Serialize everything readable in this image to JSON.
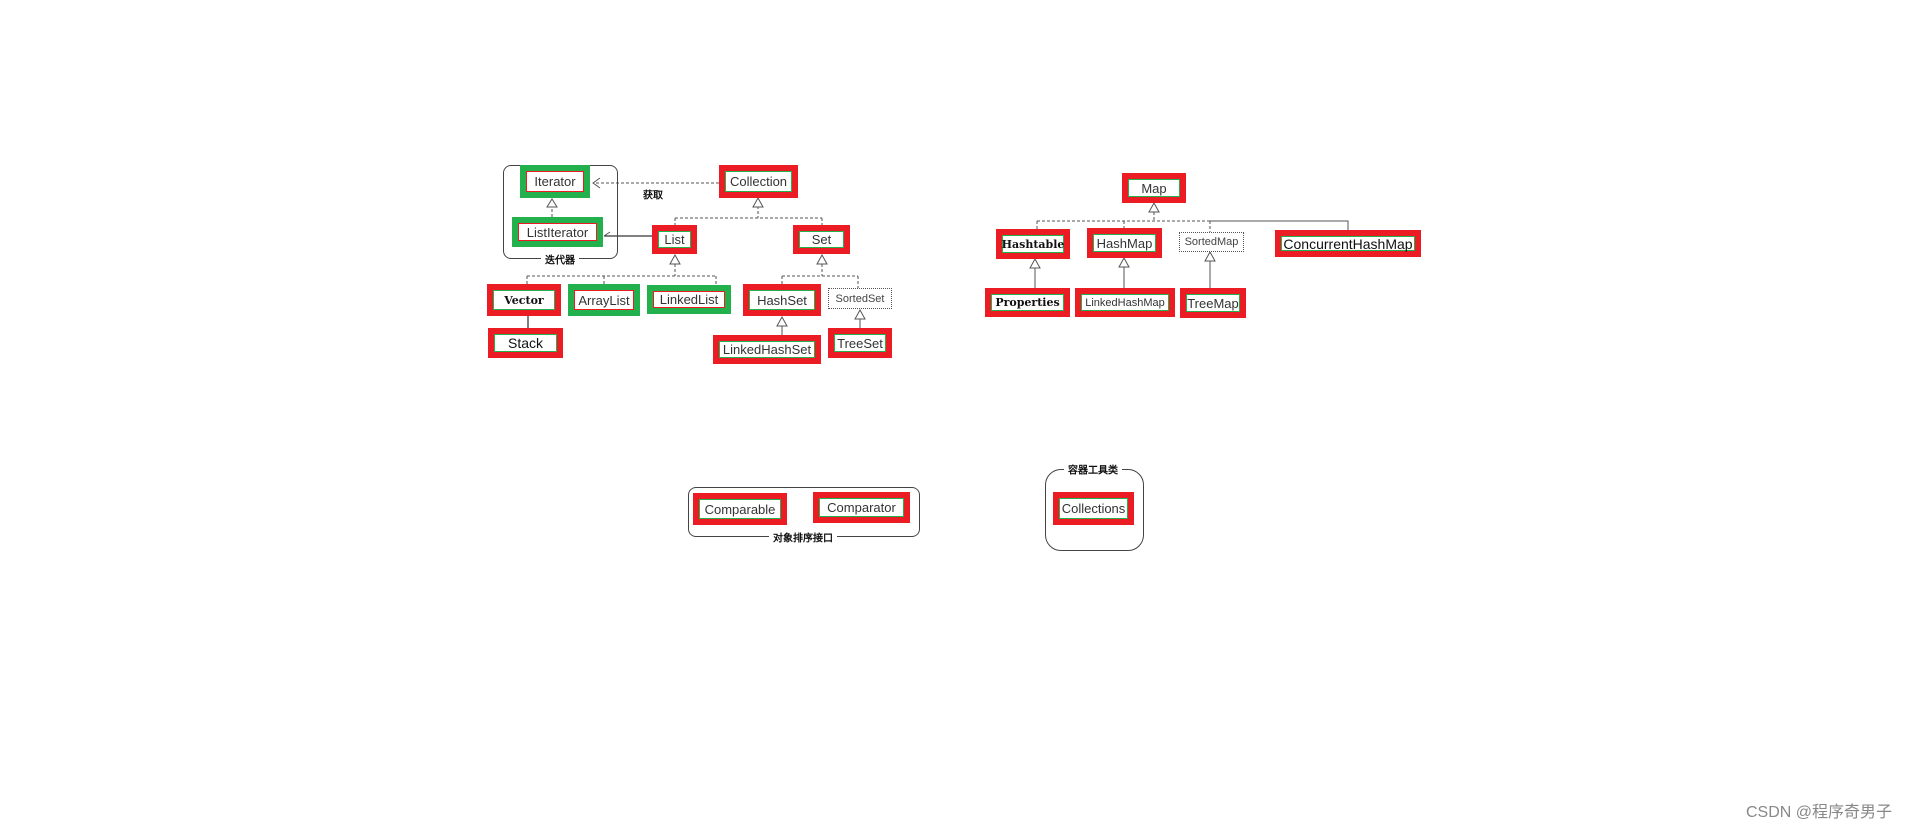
{
  "colors": {
    "highlight_red": "#ec1c24",
    "highlight_green": "#22b14c"
  },
  "collection_diagram": {
    "iterator_group_label": "迭代器",
    "get_label": "获取",
    "nodes": {
      "iterator": "Iterator",
      "list_iterator": "ListIterator",
      "collection": "Collection",
      "list": "List",
      "set": "Set",
      "vector": "Vector",
      "array_list": "ArrayList",
      "linked_list": "LinkedList",
      "hash_set": "HashSet",
      "sorted_set": "SortedSet",
      "stack": "Stack",
      "linked_hash_set": "LinkedHashSet",
      "tree_set": "TreeSet"
    }
  },
  "map_diagram": {
    "nodes": {
      "map": "Map",
      "hashtable": "Hashtable",
      "hash_map": "HashMap",
      "sorted_map": "SortedMap",
      "concurrent_hash_map": "ConcurrentHashMap",
      "properties": "Properties",
      "linked_hash_map": "LinkedHashMap",
      "tree_map": "TreeMap"
    }
  },
  "sorting": {
    "group_label": "对象排序接口",
    "comparable": "Comparable",
    "comparator": "Comparator"
  },
  "utility": {
    "group_label": "容器工具类",
    "collections": "Collections"
  },
  "watermark": "CSDN @程序奇男子"
}
